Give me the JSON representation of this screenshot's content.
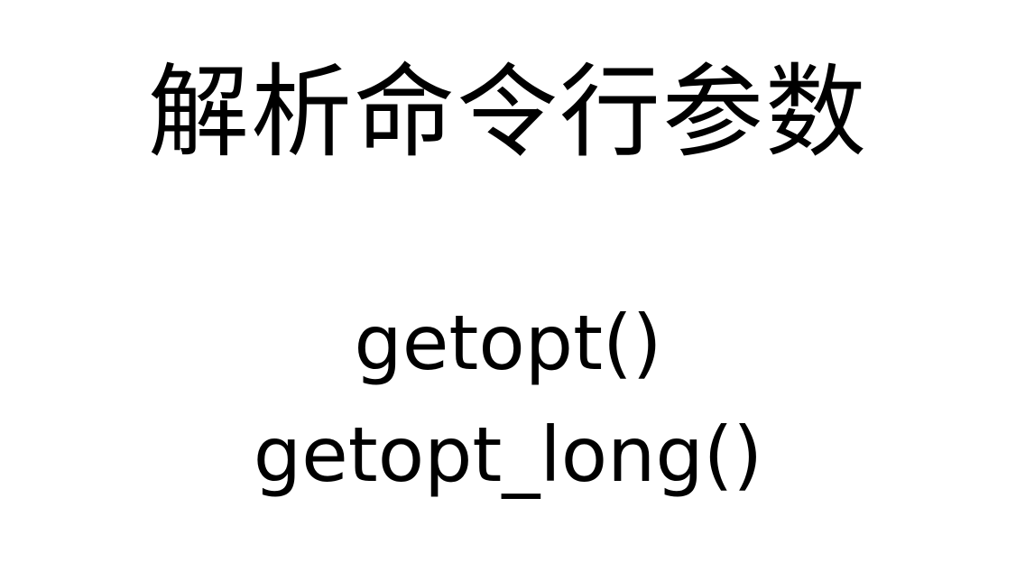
{
  "slide": {
    "title": "解析命令行参数",
    "lines": [
      "getopt()",
      "getopt_long()"
    ]
  },
  "colors": {
    "background": "#ffffff",
    "text": "#000000"
  }
}
